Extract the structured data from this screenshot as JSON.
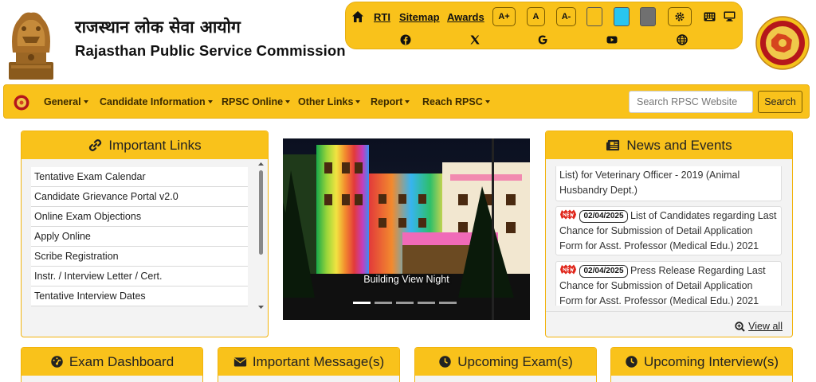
{
  "header": {
    "title_hindi": "राजस्थान लोक सेवा आयोग",
    "title_english": "Rajasthan Public Service Commission"
  },
  "topbar": {
    "links": [
      "RTI",
      "Sitemap",
      "Awards"
    ],
    "font_sizes": [
      "A+",
      "A",
      "A-"
    ],
    "theme_swatches": [
      "#f9c21b",
      "#29c5f0",
      "#707070"
    ],
    "icons": [
      "home-icon",
      "gear-icon",
      "keyboard-icon",
      "monitor-icon",
      "facebook-icon",
      "x-twitter-icon",
      "google-icon",
      "youtube-icon",
      "globe-icon"
    ]
  },
  "nav": {
    "items": [
      "General",
      "Candidate Information",
      "RPSC Online",
      "Other Links",
      "Report",
      "Reach RPSC"
    ],
    "search_placeholder": "Search RPSC Website",
    "search_button": "Search"
  },
  "important_links": {
    "title": "Important Links",
    "items": [
      "Tentative Exam Calendar",
      "Candidate Grievance Portal v2.0",
      "Online Exam Objections",
      "Apply Online",
      "Scribe Registration",
      "Instr. / Interview Letter / Cert.",
      "Tentative Interview Dates"
    ]
  },
  "carousel": {
    "caption": "Building View Night",
    "slide_count": 5,
    "active_slide": 1
  },
  "news": {
    "title": "News and Events",
    "items": [
      {
        "text": "List) for Veterinary Officer - 2019 (Animal Husbandry Dept.)"
      },
      {
        "date": "02/04/2025",
        "text": "List of Candidates regarding Last Chance for Submission of Detail Application Form for Asst. Professor (Medical Edu.) 2021"
      },
      {
        "date": "02/04/2025",
        "text": "Press Release Regarding Last Chance for Submission of Detail Application Form for Asst. Professor (Medical Edu.) 2021"
      }
    ],
    "view_all": "View all"
  },
  "bottom_panels": [
    {
      "title": "Exam Dashboard",
      "icon": "dashboard-icon"
    },
    {
      "title": "Important Message(s)",
      "icon": "envelope-icon"
    },
    {
      "title": "Upcoming Exam(s)",
      "icon": "clock-icon"
    },
    {
      "title": "Upcoming Interview(s)",
      "icon": "clock-icon"
    }
  ],
  "colors": {
    "accent": "#f9c21b",
    "border": "#f2b30c"
  }
}
